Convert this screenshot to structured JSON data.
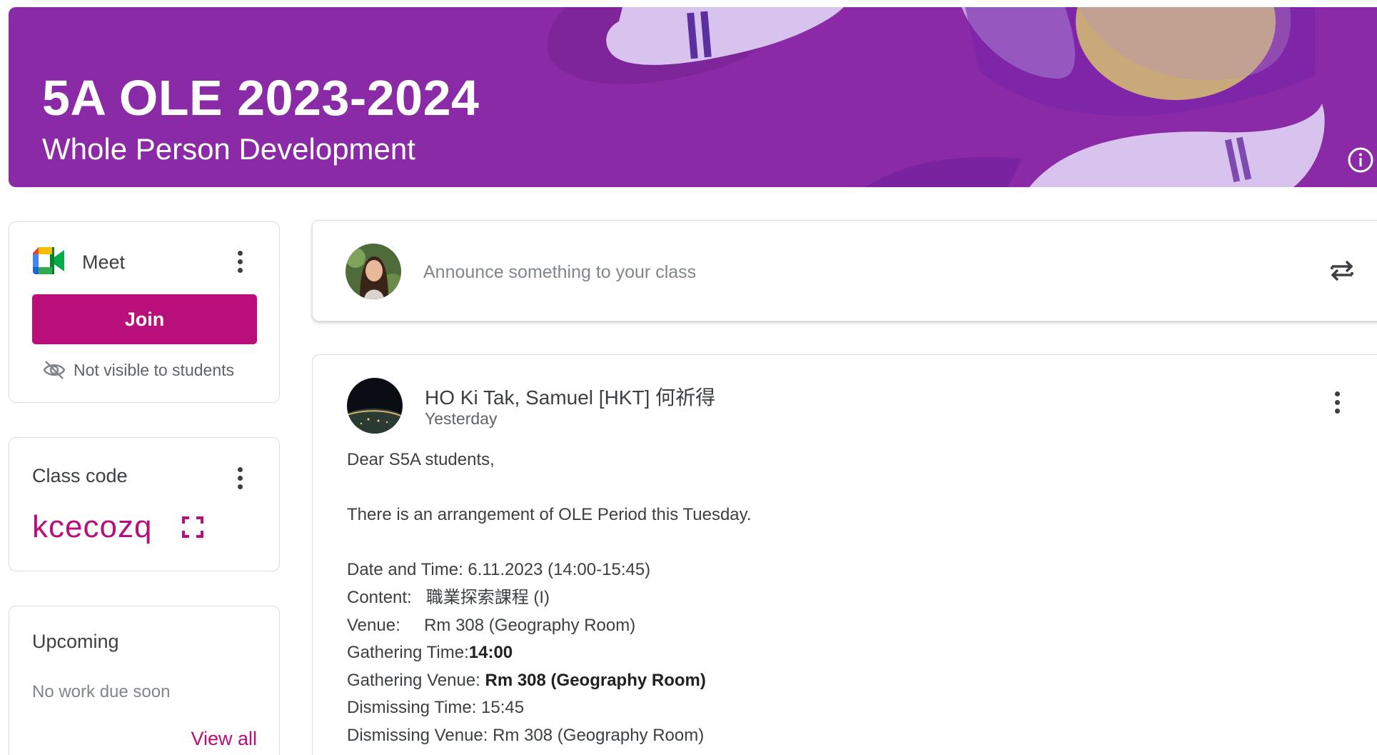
{
  "banner": {
    "title": "5A OLE 2023-2024",
    "subtitle": "Whole Person Development",
    "info_icon": "info-icon",
    "background_color": "#8b2aa6"
  },
  "meet": {
    "label": "Meet",
    "join_label": "Join",
    "visibility_note": "Not visible to students",
    "accent_color": "#b80f7a"
  },
  "class_code": {
    "label": "Class code",
    "value": "kcecozq"
  },
  "upcoming": {
    "title": "Upcoming",
    "empty_text": "No work due soon",
    "view_all_label": "View all"
  },
  "announce": {
    "placeholder": "Announce something to your class"
  },
  "post": {
    "author": "HO Ki Tak, Samuel [HKT] 何祈得",
    "time": "Yesterday",
    "greeting": "Dear S5A students,",
    "intro": "There is an arrangement of OLE Period this Tuesday.",
    "date_line": "Date and Time: 6.11.2023 (14:00-15:45)",
    "content_line": "Content:   職業探索課程 (I)",
    "venue_line": "Venue:     Rm 308 (Geography Room)",
    "gathering_time_label": "Gathering Time:",
    "gathering_time_value": "14:00",
    "gathering_venue_label": "Gathering Venue: ",
    "gathering_venue_value": "Rm 308 (Geography Room)",
    "dismissing_time_line": "Dismissing Time: 15:45",
    "dismissing_venue_line": "Dismissing Venue: Rm 308 (Geography Room)"
  }
}
